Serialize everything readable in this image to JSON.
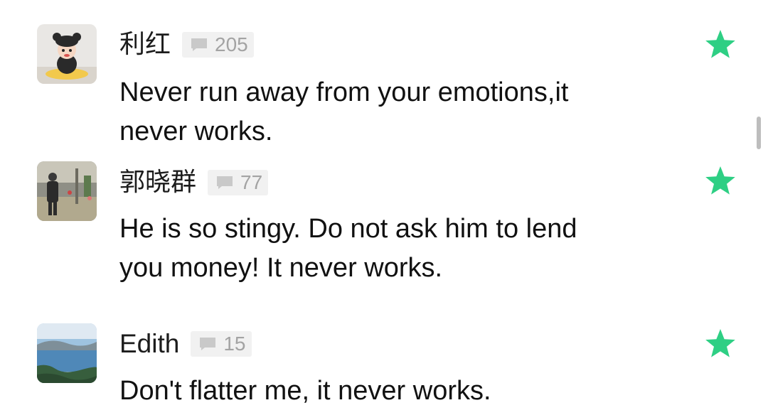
{
  "colors": {
    "accent_star": "#2ecf84",
    "badge_bg": "#f1f1f1",
    "badge_text": "#a3a3a3",
    "name_text": "#1c1c1c",
    "body_text": "#111111"
  },
  "comments": [
    {
      "name": "利红",
      "count": "205",
      "text": "Never run away from your emotions,it\nnever works.",
      "avatar": "avatar-doll",
      "icon": "comment-icon",
      "star": "star-icon"
    },
    {
      "name": "郭晓群",
      "count": "77",
      "text": "He is so stingy. Do not ask him to lend\nyou money! It never works.",
      "avatar": "avatar-street-photo",
      "icon": "comment-icon",
      "star": "star-icon"
    },
    {
      "name": "Edith",
      "count": "15",
      "text": " Don't flatter me, it never works.",
      "avatar": "avatar-lake-landscape",
      "icon": "comment-icon",
      "star": "star-icon"
    }
  ]
}
